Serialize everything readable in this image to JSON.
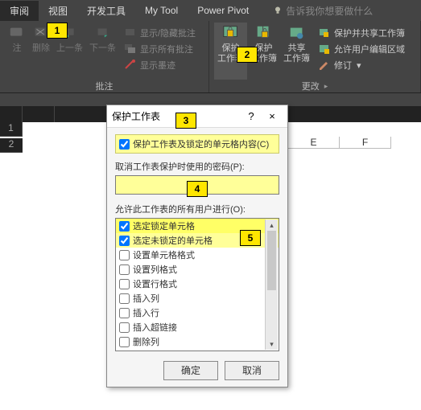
{
  "tabs": {
    "review": "审阅",
    "view": "视图",
    "dev": "开发工具",
    "mytool": "My Tool",
    "pivot": "Power Pivot",
    "tell_me": "告诉我你想要做什么"
  },
  "grp_comments": {
    "delete": "删除",
    "prev": "上一条",
    "next": "下一条",
    "show_hide": "显示/隐藏批注",
    "show_all": "显示所有批注",
    "show_ink": "显示墨迹",
    "label": "批注"
  },
  "grp_protect": {
    "protect_sheet": "保护\n工作表",
    "protect_book": "保护\n工作簿",
    "share_book": "共享\n工作簿",
    "protect_share": "保护并共享工作簿",
    "allow_edit": "允许用户编辑区域",
    "revisions": "修订",
    "label": "更改"
  },
  "sheet_cols": {
    "e": "E",
    "f": "F"
  },
  "sheet_rows": [
    "1"
  ],
  "dialog": {
    "title": "保护工作表",
    "help": "?",
    "close": "×",
    "ck_main": "保护工作表及锁定的单元格内容(C)",
    "pw_label": "取消工作表保护时使用的密码(P):",
    "pw_value": "",
    "perm_label": "允许此工作表的所有用户进行(O):",
    "items": [
      "选定锁定单元格",
      "选定未锁定的单元格",
      "设置单元格格式",
      "设置列格式",
      "设置行格式",
      "插入列",
      "插入行",
      "插入超链接",
      "删除列",
      "删除行"
    ],
    "ok": "确定",
    "cancel": "取消"
  },
  "callouts": {
    "c1": "1",
    "c2": "2",
    "c3": "3",
    "c4": "4",
    "c5": "5"
  }
}
